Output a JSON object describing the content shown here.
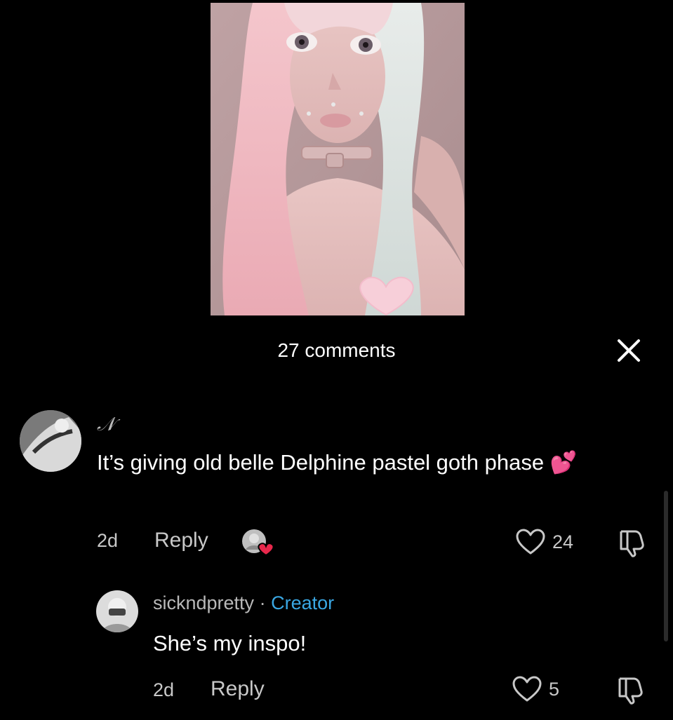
{
  "header": {
    "comments_count_label": "27 comments"
  },
  "comments": [
    {
      "username": "𝒩",
      "text": "It’s giving old belle Delphine pastel goth phase 💕",
      "time": "2d",
      "reply_label": "Reply",
      "likes": "24",
      "creator_liked": true,
      "replies": [
        {
          "username": "sickndpretty",
          "separator": "·",
          "badge": "Creator",
          "text": "She’s my inspo!",
          "time": "2d",
          "reply_label": "Reply",
          "likes": "5"
        }
      ]
    }
  ],
  "colors": {
    "background": "#000000",
    "creator_badge": "#3aa7e3",
    "secondary_text": "#c8c8c8",
    "liked_heart": "#e8284c"
  },
  "icons": {
    "close": "close-icon",
    "like": "heart-outline-icon",
    "dislike": "thumbs-down-icon",
    "creator_liked": "creator-heart-badge-icon"
  }
}
